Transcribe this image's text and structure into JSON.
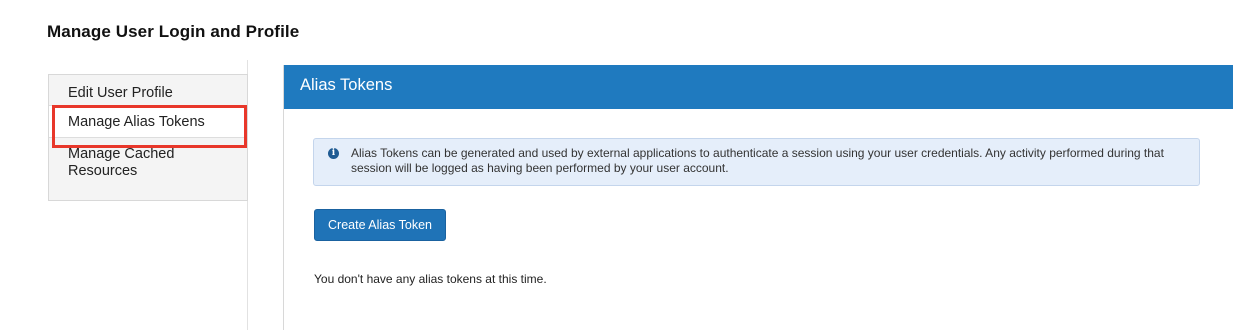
{
  "page": {
    "title": "Manage User Login and Profile"
  },
  "sidebar": {
    "items": [
      {
        "label": "Edit User Profile",
        "active": false
      },
      {
        "label": "Manage Alias Tokens",
        "active": true
      },
      {
        "label": "Manage Cached Resources",
        "active": false
      }
    ]
  },
  "panel": {
    "header": "Alias Tokens",
    "info_text": "Alias Tokens can be generated and used by external applications to authenticate a session using your user credentials. Any activity performed during that session will be logged as having been performed by your user account.",
    "info_icon": "info-circle-icon",
    "create_button_label": "Create Alias Token",
    "empty_message": "You don't have any alias tokens at this time."
  },
  "colors": {
    "header_blue": "#1f7abf",
    "button_blue": "#1f73b7",
    "info_bg": "#e5eefa",
    "highlight_red": "#e8372a"
  }
}
